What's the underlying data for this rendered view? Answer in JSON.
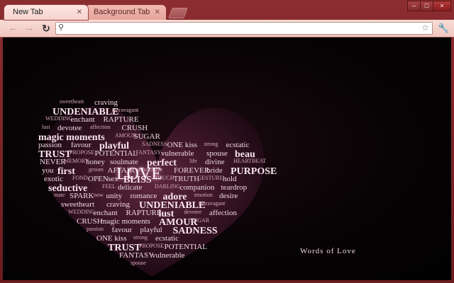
{
  "tabs": [
    {
      "label": "New Tab",
      "active": true
    },
    {
      "label": "Background Tab",
      "active": false
    }
  ],
  "window_controls": {
    "minimize": "–",
    "maximize": "□",
    "close": "×"
  },
  "toolbar": {
    "back": "←",
    "forward": "→",
    "reload": "↻",
    "omnibox_value": "",
    "search_icon": "search-icon",
    "star_icon": "star-icon",
    "wrench_icon": "wrench-icon"
  },
  "theme": {
    "frame_color": "#7a2528",
    "tab_color": "#f7d6d0",
    "page_bg": "#050204"
  },
  "wallpaper": {
    "brand": "Words of Love",
    "center_word": "LOVE",
    "words": [
      "sweetheart",
      "craving",
      "UNDENIABLE",
      "extravagant",
      "WEDDING",
      "enchant",
      "RAPTURE",
      "lust",
      "devotee",
      "affection",
      "CRUSH",
      "magic moments",
      "AMOUR",
      "SUGAR",
      "passion",
      "favour",
      "playful",
      "SADNESS",
      "ONE kiss",
      "strong",
      "ecstatic",
      "TRUST",
      "PROPOSE",
      "POTENTIAL",
      "FANTASY",
      "vulnerable",
      "spouse",
      "beau",
      "NEVER",
      "MEMORY",
      "honey",
      "soulmate",
      "perfect",
      "life",
      "divine",
      "HEARTBEAT",
      "you",
      "first",
      "groom",
      "AFFAIR",
      "provocative",
      "FOREVER",
      "bride",
      "PURPOSE",
      "exotic",
      "FOND",
      "OPEN",
      "sex",
      "BLISS",
      "TOUCH",
      "TRUTH",
      "GESTURE",
      "hold",
      "seductive",
      "FEEL",
      "delicate",
      "DARLING",
      "companion",
      "teardrop",
      "mate",
      "SPARK",
      "now",
      "unity",
      "romance",
      "adore",
      "emotion",
      "desire"
    ]
  }
}
